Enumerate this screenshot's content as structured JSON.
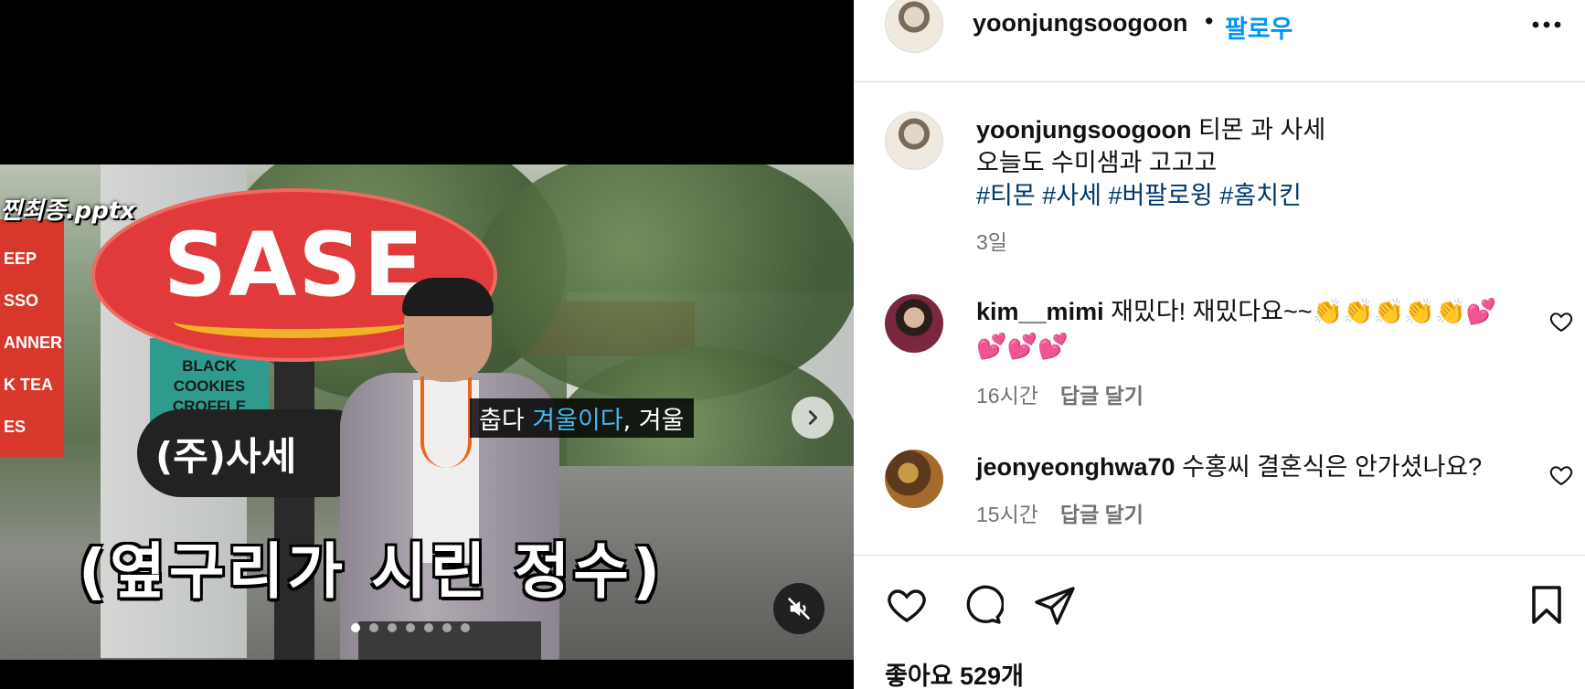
{
  "media": {
    "subtitle_small_pre": "춥다 ",
    "subtitle_small_highlight": "겨울이다",
    "subtitle_small_post": ", 겨울",
    "subtitle_big": "(옆구리가 시린 정수)",
    "sign_sase": "SASE",
    "sign_corp": "(주)사세",
    "overlay_tag": "찐최종.pptx",
    "menu_board": [
      "EEP",
      "SSO",
      "ANNER",
      "K TEA",
      "ES"
    ],
    "cafe_board": [
      "BLACK",
      "COOKIES",
      "CROFFLE"
    ],
    "carousel": {
      "total": 7,
      "active_index": 1
    },
    "icons": {
      "next": "chevron-right-icon",
      "mute": "speaker-muted-icon"
    }
  },
  "header": {
    "username": "yoonjungsoogoon",
    "separator": "•",
    "follow_label": "팔로우",
    "more_icon": "ellipsis-icon"
  },
  "caption": {
    "username": "yoonjungsoogoon",
    "line1": " 티몬 과 사세",
    "line2": "오늘도 수미샘과 고고고",
    "hashtags": [
      "#티몬",
      "#사세",
      "#버팔로윙",
      "#홈치킨"
    ],
    "time": "3일"
  },
  "comments": [
    {
      "username": "kim__mimi",
      "text": " 재밌다! 재밌다요~~👏👏👏👏👏💕💕💕💕",
      "time": "16시간",
      "reply_label": "답글 달기"
    },
    {
      "username": "jeonyeonghwa70",
      "text": " 수홍씨 결혼식은 안가셨나요?",
      "time": "15시간",
      "reply_label": "답글 달기"
    }
  ],
  "actions": {
    "icons": [
      "heart-icon",
      "comment-icon",
      "share-icon",
      "bookmark-icon"
    ]
  },
  "likes": {
    "label": "좋아요 529개"
  },
  "colors": {
    "link_blue": "#0095f6",
    "hashtag": "#00376b",
    "muted": "#737373",
    "divider": "#dbdbdb"
  }
}
